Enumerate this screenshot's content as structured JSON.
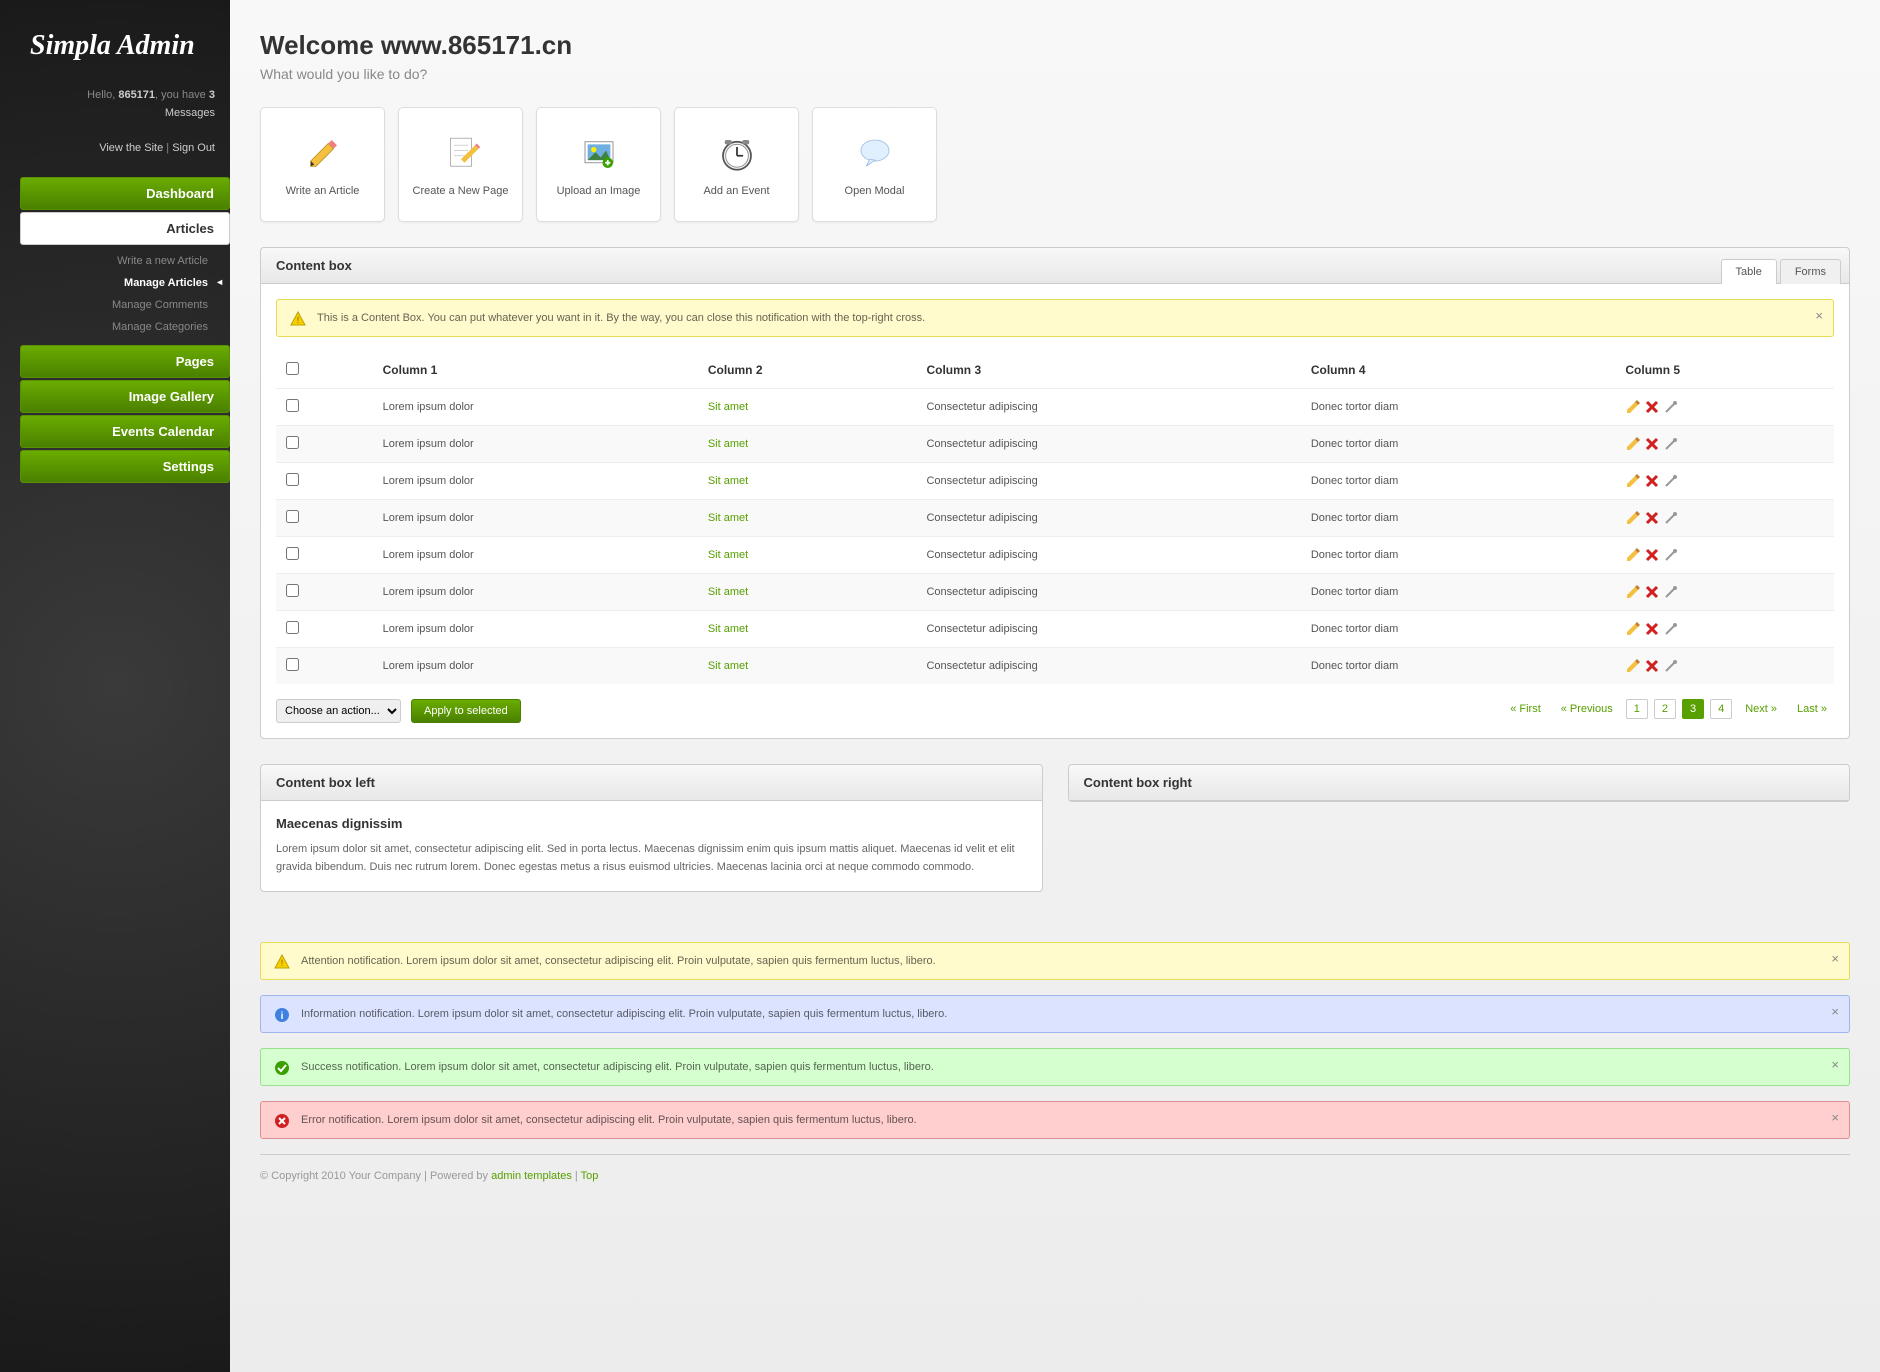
{
  "logo": "Simpla Admin",
  "profile": {
    "greeting": "Hello, ",
    "user": "865171",
    "mid": ", you have ",
    "msg_count": "3",
    "msg_label": "Messages",
    "view_site": "View the Site",
    "sign_out": "Sign Out"
  },
  "nav": [
    {
      "label": "Dashboard",
      "current": false
    },
    {
      "label": "Articles",
      "current": true,
      "sub": [
        {
          "label": "Write a new Article",
          "current": false
        },
        {
          "label": "Manage Articles",
          "current": true
        },
        {
          "label": "Manage Comments",
          "current": false
        },
        {
          "label": "Manage Categories",
          "current": false
        }
      ]
    },
    {
      "label": "Pages",
      "current": false
    },
    {
      "label": "Image Gallery",
      "current": false
    },
    {
      "label": "Events Calendar",
      "current": false
    },
    {
      "label": "Settings",
      "current": false
    }
  ],
  "page_title": "Welcome www.865171.cn",
  "intro": "What would you like to do?",
  "shortcuts": [
    {
      "label": "Write an Article",
      "icon": "pencil"
    },
    {
      "label": "Create a New Page",
      "icon": "page"
    },
    {
      "label": "Upload an Image",
      "icon": "image"
    },
    {
      "label": "Add an Event",
      "icon": "clock"
    },
    {
      "label": "Open Modal",
      "icon": "speech"
    }
  ],
  "box1": {
    "title": "Content box",
    "tabs": [
      "Table",
      "Forms"
    ],
    "active_tab": 0
  },
  "table_notif": "This is a Content Box. You can put whatever you want in it. By the way, you can close this notification with the top-right cross.",
  "columns": [
    "Column 1",
    "Column 2",
    "Column 3",
    "Column 4",
    "Column 5"
  ],
  "rows": [
    {
      "c1": "Lorem ipsum dolor",
      "c2": "Sit amet",
      "c3": "Consectetur adipiscing",
      "c4": "Donec tortor diam"
    },
    {
      "c1": "Lorem ipsum dolor",
      "c2": "Sit amet",
      "c3": "Consectetur adipiscing",
      "c4": "Donec tortor diam"
    },
    {
      "c1": "Lorem ipsum dolor",
      "c2": "Sit amet",
      "c3": "Consectetur adipiscing",
      "c4": "Donec tortor diam"
    },
    {
      "c1": "Lorem ipsum dolor",
      "c2": "Sit amet",
      "c3": "Consectetur adipiscing",
      "c4": "Donec tortor diam"
    },
    {
      "c1": "Lorem ipsum dolor",
      "c2": "Sit amet",
      "c3": "Consectetur adipiscing",
      "c4": "Donec tortor diam"
    },
    {
      "c1": "Lorem ipsum dolor",
      "c2": "Sit amet",
      "c3": "Consectetur adipiscing",
      "c4": "Donec tortor diam"
    },
    {
      "c1": "Lorem ipsum dolor",
      "c2": "Sit amet",
      "c3": "Consectetur adipiscing",
      "c4": "Donec tortor diam"
    },
    {
      "c1": "Lorem ipsum dolor",
      "c2": "Sit amet",
      "c3": "Consectetur adipiscing",
      "c4": "Donec tortor diam"
    }
  ],
  "bulk": {
    "placeholder": "Choose an action...",
    "apply": "Apply to selected"
  },
  "pagination": {
    "first": "« First",
    "prev": "« Previous",
    "pages": [
      "1",
      "2",
      "3",
      "4"
    ],
    "current": 2,
    "next": "Next »",
    "last": "Last »"
  },
  "box_left": {
    "title": "Content box left",
    "heading": "Maecenas dignissim",
    "body": "Lorem ipsum dolor sit amet, consectetur adipiscing elit. Sed in porta lectus. Maecenas dignissim enim quis ipsum mattis aliquet. Maecenas id velit et elit gravida bibendum. Duis nec rutrum lorem. Donec egestas metus a risus euismod ultricies. Maecenas lacinia orci at neque commodo commodo."
  },
  "box_right": {
    "title": "Content box right"
  },
  "notifs": {
    "attention": "Attention notification. Lorem ipsum dolor sit amet, consectetur adipiscing elit. Proin vulputate, sapien quis fermentum luctus, libero.",
    "information": "Information notification. Lorem ipsum dolor sit amet, consectetur adipiscing elit. Proin vulputate, sapien quis fermentum luctus, libero.",
    "success": "Success notification. Lorem ipsum dolor sit amet, consectetur adipiscing elit. Proin vulputate, sapien quis fermentum luctus, libero.",
    "error": "Error notification. Lorem ipsum dolor sit amet, consectetur adipiscing elit. Proin vulputate, sapien quis fermentum luctus, libero."
  },
  "footer": {
    "copyright": "© Copyright 2010 Your Company | Powered by ",
    "link1": "admin templates",
    "sep": " | ",
    "link2": "Top"
  }
}
